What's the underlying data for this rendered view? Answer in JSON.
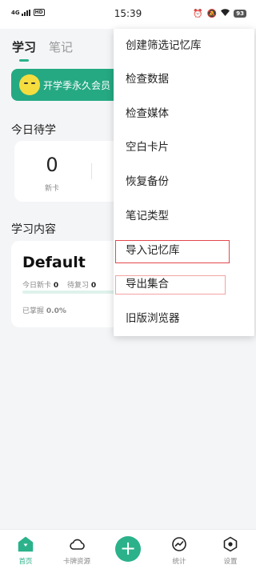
{
  "status_bar": {
    "network": "4G",
    "hd": "HD",
    "time": "15:39",
    "battery": "93"
  },
  "tabs": [
    {
      "label": "学习",
      "active": true
    },
    {
      "label": "笔记",
      "active": false
    }
  ],
  "promo": {
    "text": "开学季永久会员"
  },
  "today": {
    "title": "今日待学",
    "new_count": "0",
    "new_label": "新卡"
  },
  "study": {
    "title": "学习内容",
    "deck": {
      "name": "Default",
      "new_today_label": "今日新卡",
      "new_today_value": "0",
      "review_label": "待复习",
      "review_value": "0",
      "mastered_label": "已掌握",
      "mastered_value": "0.0%",
      "progress_fraction": 0.0
    }
  },
  "menu": {
    "items": [
      {
        "label": "创建筛选记忆库"
      },
      {
        "label": "检查数据"
      },
      {
        "label": "检查媒体"
      },
      {
        "label": "空白卡片"
      },
      {
        "label": "恢复备份"
      },
      {
        "label": "笔记类型"
      },
      {
        "label": "导入记忆库",
        "highlighted": "strong"
      },
      {
        "label": "导出集合",
        "highlighted": "light"
      },
      {
        "label": "旧版浏览器"
      }
    ]
  },
  "bottom_nav": {
    "items": [
      {
        "label": "首页",
        "icon": "home-icon",
        "active": true
      },
      {
        "label": "卡牌资源",
        "icon": "cloud-icon",
        "active": false
      },
      {
        "label": "",
        "icon": "add-icon",
        "active": false
      },
      {
        "label": "统计",
        "icon": "stats-icon",
        "active": false
      },
      {
        "label": "设置",
        "icon": "settings-icon",
        "active": false
      }
    ],
    "add_symbol": "+"
  },
  "colors": {
    "accent": "#2bb28a",
    "promo_bg": "#25a983",
    "highlight_red": "#e5484d"
  }
}
